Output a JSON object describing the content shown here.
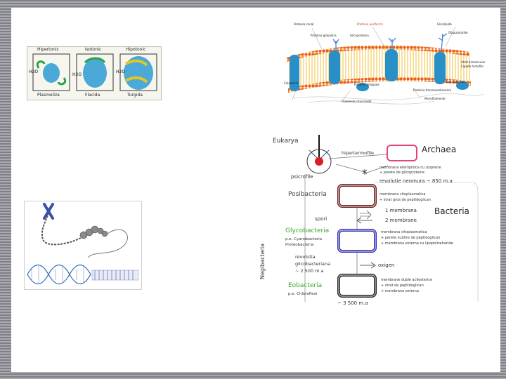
{
  "osmosis": {
    "labels": [
      "Hipertonic",
      "Isotonic",
      "Hipotonic"
    ],
    "states": [
      "Plasmoliza",
      "Flacida",
      "Turgida"
    ],
    "water": "H2O",
    "colors": {
      "cell": "#4aa9d6",
      "arrow_green": "#2aa44a",
      "arrow_yellow": "#e8c423"
    }
  },
  "membrane": {
    "labels": {
      "a": "Proteina canal",
      "b": "Proteina globulara",
      "c": "Proteina periferica",
      "d": "Glicoproteina",
      "e": "Glicolipide",
      "f": "Oligozaharide",
      "g": "Strat bimolecular",
      "h": "Capete hidrofile",
      "i": "Cozi hidrofobe",
      "j": "Colesterol",
      "k": "Proteina integrala",
      "l": "Proteina transmembranara",
      "m": "Filamente citoschelet",
      "n": "Microfilamente"
    }
  },
  "dna": {
    "label_hidden": ""
  },
  "phylogeny": {
    "eukarya": "Eukarya",
    "archaea": "Archaea",
    "hipertermofile": "hipertermofile",
    "psicrofile": "psicrofile",
    "archaea_note_1": "membrana eterlipidica cu izoprene",
    "archaea_note_2": "+ perete de glicoproteine",
    "revolution": "revolutie neomura ~ 850 m.a",
    "posibacteria": "Posibacteria",
    "posi_note_1": "membrana citoplasmatica",
    "posi_note_2": "+ strat gros de peptidoglican",
    "one_membrane": "1 membrana",
    "bacteria": "Bacteria",
    "two_membranes": "2 membrane",
    "spores": "spori",
    "glycobacteria": "Glycobacteria",
    "glyco_eg_1": "p.e. Cyanobacteria",
    "glyco_eg_2": "Proteobacteria",
    "glyco_note_1": "membrana citoplasmatica",
    "glyco_note_2": "+ perete subtire de peptidoglican",
    "glyco_note_3": "+ membrana externa cu lipopolizaharide",
    "glyco_rev_1": "revolutia",
    "glyco_rev_2": "glicobacteriana",
    "glyco_rev_3": "~ 2 500 m.a",
    "oxygen": "oxigen",
    "eobacteria": "Eobacteria",
    "eo_eg": "p.e. Chloroflexi",
    "eo_note_1": "membrane duble acilesterice",
    "eo_note_2": "+ strat de peptidoglican",
    "eo_note_3": "+ membrana externa",
    "age": "~ 3 500 m.a",
    "negibacteria": "Negibacteria"
  }
}
